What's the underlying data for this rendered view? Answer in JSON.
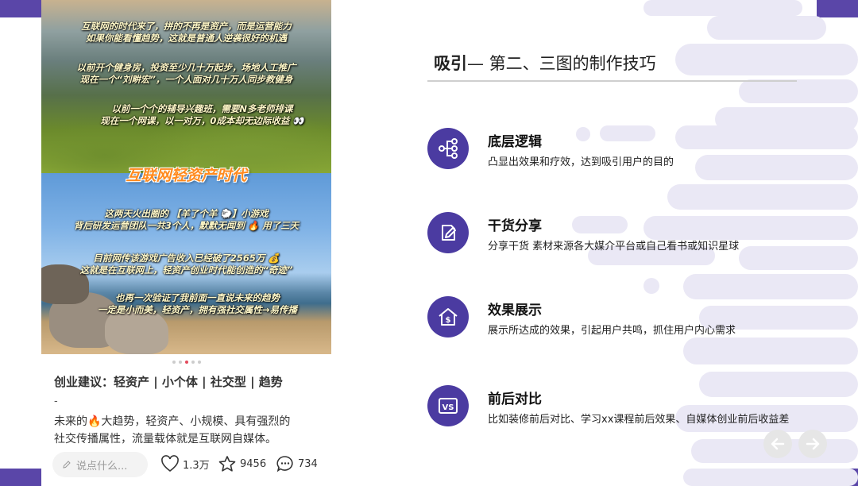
{
  "post": {
    "photo_lines_top": [
      "互联网的时代来了，拼的不再是资产，而是运营能力",
      "如果你能看懂趋势，这就是普通人逆袭很好的机遇",
      "以前开个健身房，投资至少几十万起步，场地人工推广",
      "现在一个“刘畊宏”，一个人面对几十万人同步教健身",
      "以前一个个的辅导兴趣班，需要N多老师排课",
      "现在一个网课，以一对万，0成本却无边际收益 👀"
    ],
    "photo_title": "互联网轻资产时代",
    "photo_lines_bottom": [
      "这两天火出圈的 【羊了个羊 🐑】小游戏",
      "背后研发运营团队一共3个人，默默无闻到 🔥 用了三天",
      "目前网传该游戏广告收入已经破了2565万 💰",
      "这就是在互联网上，轻资产创业时代能创造的“奇迹”",
      "也再一次验证了我前面一直说未来的趋势",
      "一定是小而美，轻资产，拥有强社交属性→易传播"
    ],
    "title": "创业建议：轻资产 | 小个体 | 社交型 | 趋势",
    "dash": "-",
    "body_line1": "未来的🔥大趋势，轻资产、小规模、具有强烈的",
    "body_line2": "社交传播属性，流量载体就是互联网自媒体。",
    "comment_placeholder": "说点什么...",
    "likes": "1.3万",
    "stars": "9456",
    "comments": "734"
  },
  "heading": {
    "bold": "吸引",
    "rest": "— 第二、三图的制作技巧"
  },
  "items": [
    {
      "icon": "flowchart-icon",
      "title": "底层逻辑",
      "desc": "凸显出效果和疗效，达到吸引用户的目的"
    },
    {
      "icon": "edit-icon",
      "title": "干货分享",
      "desc": "分享干货 素材来源各大媒介平台或自己看书或知识星球"
    },
    {
      "icon": "money-house-icon",
      "title": "效果展示",
      "desc": "展示所达成的效果，引起用户共鸣，抓住用户内心需求"
    },
    {
      "icon": "vs-icon",
      "title": "前后对比",
      "desc": "比如装修前后对比、学习xx课程前后效果、自媒体创业前后收益差"
    }
  ],
  "colors": {
    "accent": "#4b3ba1",
    "corner": "#5a46a8",
    "deco": "#eae8f5"
  }
}
